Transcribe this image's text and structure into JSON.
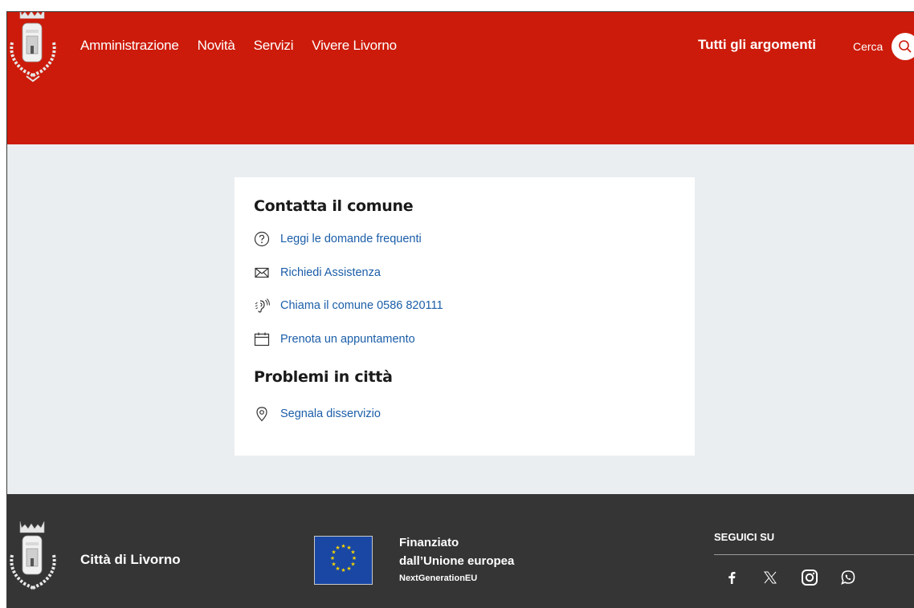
{
  "header": {
    "nav": [
      "Amministrazione",
      "Novità",
      "Servizi",
      "Vivere Livorno"
    ],
    "topics_label": "Tutti gli argomenti",
    "search_label": "Cerca"
  },
  "contact_card": {
    "title": "Contatta il comune",
    "links": [
      {
        "icon": "question-icon",
        "label": "Leggi le domande frequenti"
      },
      {
        "icon": "mail-icon",
        "label": "Richiedi Assistenza"
      },
      {
        "icon": "hearing-icon",
        "label": "Chiama il comune 0586 820111"
      },
      {
        "icon": "calendar-icon",
        "label": "Prenota un appuntamento"
      }
    ],
    "problems_title": "Problemi in città",
    "problems_link": {
      "icon": "map-pin-icon",
      "label": "Segnala disservizio"
    }
  },
  "footer": {
    "city": "Città di Livorno",
    "eu_line1": "Finanziato",
    "eu_line2": "dall’Unione europea",
    "eu_line3": "NextGenerationEU",
    "follow_label": "SEGUICI SU",
    "social": [
      "facebook-icon",
      "x-icon",
      "instagram-icon",
      "whatsapp-icon"
    ]
  },
  "colors": {
    "header_red": "#cc1b0a",
    "link_blue": "#1b5ea8",
    "footer_dark": "#353535",
    "main_bg": "#ebeef1"
  }
}
